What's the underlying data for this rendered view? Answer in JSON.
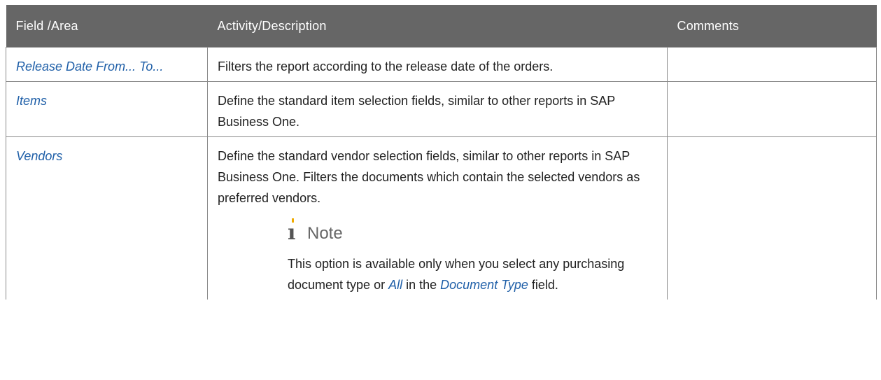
{
  "table": {
    "headers": [
      "Field /Area",
      "Activity/Description",
      "Comments"
    ],
    "rows": [
      {
        "field": "Release Date From... To...",
        "description": "Filters the report according to the release date of the orders.",
        "comments": ""
      },
      {
        "field": "Items",
        "description": "Define the standard item selection fields, similar to other reports in SAP Business One.",
        "comments": ""
      },
      {
        "field": "Vendors",
        "description": "Define the standard vendor selection fields, similar to other reports in SAP Business One. Filters the documents which contain the selected vendors as preferred vendors.",
        "comments": "",
        "note": {
          "icon": "info-icon",
          "title": "Note",
          "text_before": "This option is available only when you select any purchasing document type or ",
          "link1": "All",
          "text_middle": " in the ",
          "link2": "Document Type",
          "text_after": " field."
        }
      }
    ]
  },
  "colors": {
    "header_bg": "#666666",
    "field_link": "#1f5fa8",
    "note_accent": "#f0ab00"
  }
}
